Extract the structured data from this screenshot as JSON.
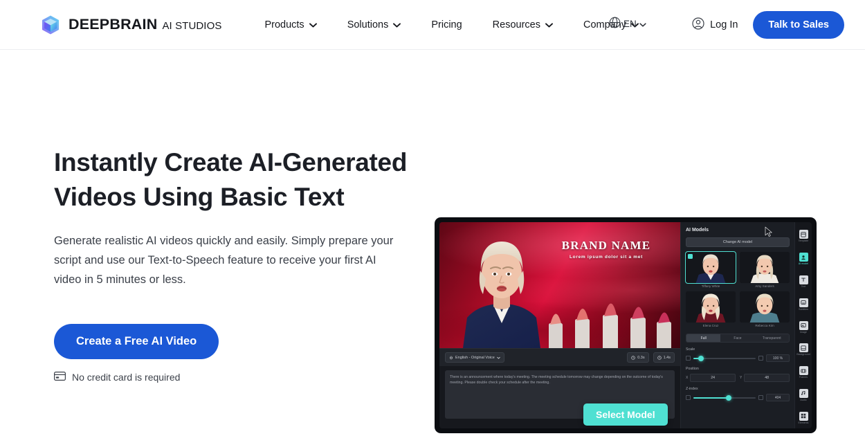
{
  "header": {
    "logo_icon": "cube-logo-icon",
    "brand_name": "DEEPBRAIN",
    "brand_sub": "AI STUDIOS",
    "nav": [
      {
        "label": "Products",
        "has_dropdown": true
      },
      {
        "label": "Solutions",
        "has_dropdown": true
      },
      {
        "label": "Pricing",
        "has_dropdown": false
      },
      {
        "label": "Resources",
        "has_dropdown": true
      },
      {
        "label": "Company",
        "has_dropdown": true
      }
    ],
    "language": {
      "icon": "globe-icon",
      "label": "EN"
    },
    "login": {
      "icon": "user-circle-icon",
      "label": "Log In"
    },
    "cta": {
      "label": "Talk to Sales",
      "color": "#1b58d6"
    }
  },
  "hero": {
    "headline": "Instantly Create AI-Generated Videos Using Basic Text",
    "subhead": "Generate realistic AI videos quickly and easily. Simply prepare your script and use our Text-to-Speech feature to receive your first AI video in 5 minutes or less.",
    "cta": {
      "label": "Create a Free AI Video",
      "color": "#1b58d6"
    },
    "note": {
      "icon": "credit-card-icon",
      "label": "No credit card is required"
    }
  },
  "preview": {
    "stage": {
      "brand_title": "BRAND NAME",
      "brand_tagline": "Lorem ipsum dolor sit a met"
    },
    "toolbar": {
      "voice_pill": "English - Original Voice",
      "duration_pill": "0.3s",
      "length_pill": "1.4s"
    },
    "script": "There is an announcement where today's meeting. The meeting schedule tomorrow may change depending on the outcome of today's meeting. Please double check your schedule after the meeting.",
    "select_model_button": {
      "label": "Select Model",
      "color": "#4fe0d2"
    },
    "panel": {
      "title": "AI Models",
      "change_button": "Change AI model",
      "models": [
        {
          "name": "Tiffany White",
          "selected": true
        },
        {
          "name": "Amy Sanders",
          "selected": false
        },
        {
          "name": "Elena Cruz",
          "selected": false
        },
        {
          "name": "Rebecca Kim",
          "selected": false
        }
      ],
      "view_tabs": [
        {
          "label": "Full",
          "active": true
        },
        {
          "label": "Face",
          "active": false
        },
        {
          "label": "Transparent",
          "active": false
        }
      ],
      "scale": {
        "label": "Scale",
        "value": "100 %",
        "percent": 12
      },
      "position": {
        "label": "Position",
        "x_key": "X",
        "x_value": "24",
        "y_key": "Y",
        "y_value": "48"
      },
      "zindex": {
        "label": "Z-index",
        "value": "404",
        "percent": 55
      }
    },
    "rail": [
      {
        "label": "Template",
        "icon": "template-icon",
        "active": false
      },
      {
        "label": "AI model",
        "icon": "avatar-icon",
        "active": true
      },
      {
        "label": "Text",
        "icon": "text-icon",
        "active": false
      },
      {
        "label": "Subtitles",
        "icon": "subtitle-icon",
        "active": false
      },
      {
        "label": "Image",
        "icon": "image-icon",
        "active": false
      },
      {
        "label": "Background",
        "icon": "background-icon",
        "active": false
      },
      {
        "label": "Frames",
        "icon": "frames-icon",
        "active": false
      },
      {
        "label": "Audio",
        "icon": "audio-icon",
        "active": false
      },
      {
        "label": "Elements",
        "icon": "elements-icon",
        "active": false
      }
    ]
  }
}
